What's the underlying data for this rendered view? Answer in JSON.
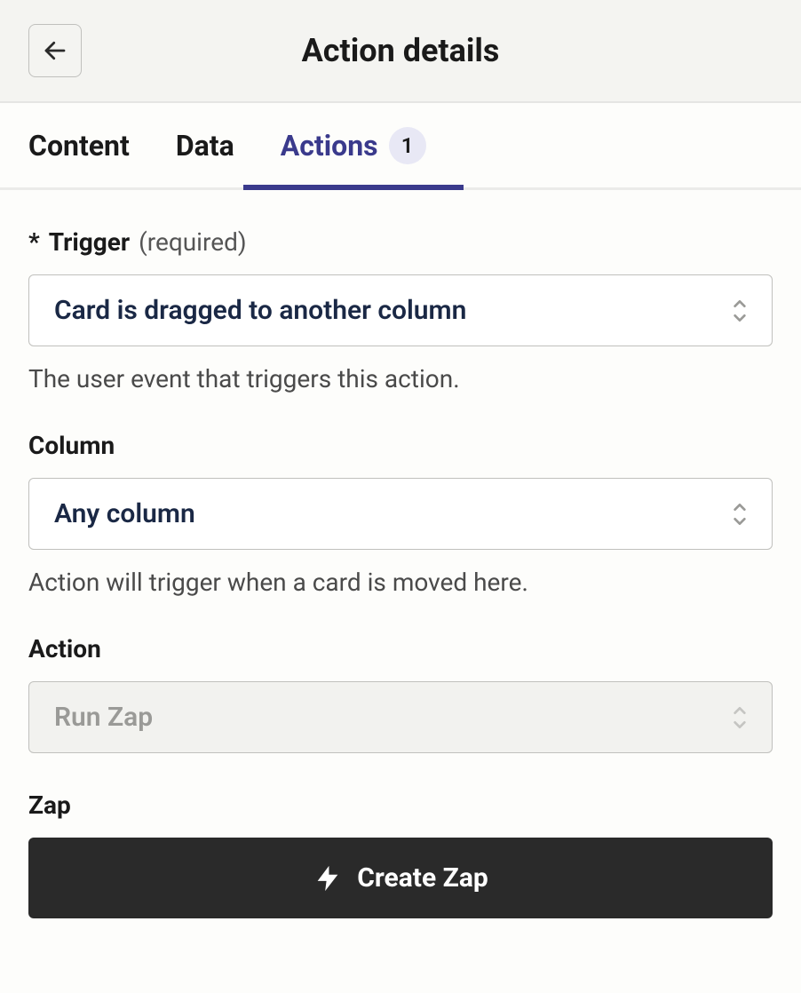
{
  "header": {
    "title": "Action details"
  },
  "tabs": {
    "content_label": "Content",
    "data_label": "Data",
    "actions_label": "Actions",
    "actions_badge": "1"
  },
  "form": {
    "trigger": {
      "asterisk": "*",
      "label": "Trigger",
      "required_text": "(required)",
      "value": "Card is dragged to another column",
      "help": "The user event that triggers this action."
    },
    "column": {
      "label": "Column",
      "value": "Any column",
      "help": "Action will trigger when a card is moved here."
    },
    "action": {
      "label": "Action",
      "value": "Run Zap"
    },
    "zap": {
      "label": "Zap",
      "button_label": "Create Zap"
    }
  }
}
